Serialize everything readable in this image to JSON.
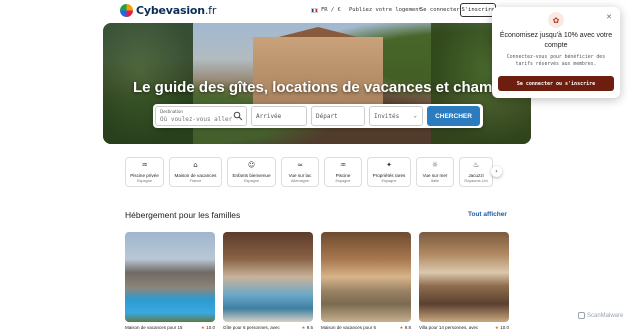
{
  "header": {
    "logo_brand": "Cybevasion",
    "logo_tld": ".fr",
    "lang": "FR / €",
    "publish": "Publiez votre logement",
    "login": "Se connecter",
    "signup": "S'inscrire"
  },
  "hero": {
    "title": "Le guide des gîtes, locations de vacances et chambres d'hôtes"
  },
  "search": {
    "destination_label": "Destination",
    "destination_placeholder": "Où voulez-vous aller ?",
    "arrive": "Arrivée",
    "depart": "Départ",
    "guests": "Invités",
    "button": "CHERCHER"
  },
  "popup": {
    "title": "Économisez jusqu'à 10% avec votre compte",
    "description": "Connectez-vous pour bénéficier des tarifs réservés aux membres.",
    "button": "Se connecter ou s'inscrire"
  },
  "categories": [
    {
      "label": "Piscine privée",
      "sub": "Espagne",
      "icon": "pool-icon",
      "glyph": "♒"
    },
    {
      "label": "Maison de vacances",
      "sub": "France",
      "icon": "house-icon",
      "glyph": "⌂"
    },
    {
      "label": "Enfants bienvenue",
      "sub": "Espagne",
      "icon": "children-icon",
      "glyph": "☺"
    },
    {
      "label": "Vue sur lac",
      "sub": "Allemagne",
      "icon": "lake-icon",
      "glyph": "≈"
    },
    {
      "label": "Piscine",
      "sub": "Espagne",
      "icon": "swim-icon",
      "glyph": "♒"
    },
    {
      "label": "Propriétés rares",
      "sub": "Espagne",
      "icon": "rare-icon",
      "glyph": "✦"
    },
    {
      "label": "Vue sur mer",
      "sub": "Italie",
      "icon": "sea-icon",
      "glyph": "☼"
    },
    {
      "label": "Jacuzzi",
      "sub": "Royaume-Uni",
      "icon": "jacuzzi-icon",
      "glyph": "♨"
    }
  ],
  "section": {
    "title": "Hébergement pour les familles",
    "see_all": "Tout afficher"
  },
  "cards": [
    {
      "name": "Maison de vacances pour 15",
      "rating": "10.0"
    },
    {
      "name": "Gîte pour 6 personnes, avec",
      "rating": "9.5"
    },
    {
      "name": "Maison de vacances pour 6",
      "rating": "9.8"
    },
    {
      "name": "Villa pour 14 personnes, avec",
      "rating": "10.0"
    }
  ],
  "watermark": "ScanMalware",
  "colors": {
    "brand_blue": "#0b2e59",
    "search_button": "#2b7bbf",
    "popup_button": "#6e1e0e",
    "link_blue": "#1e5aa0",
    "star": "#e8702a"
  }
}
